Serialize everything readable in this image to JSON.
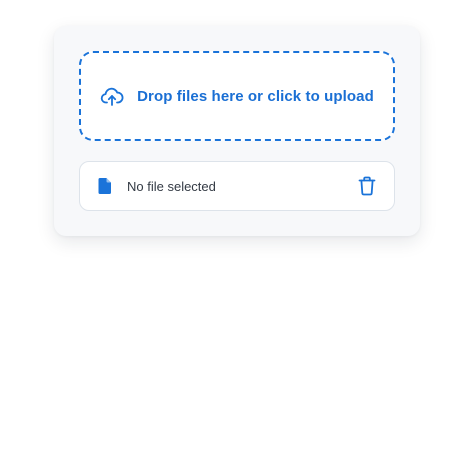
{
  "uploader": {
    "drop_label": "Drop files here or click to upload",
    "upload_icon": "cloud-upload-icon"
  },
  "file_status": {
    "label": "No file selected",
    "file_icon": "file-icon",
    "delete_icon": "trash-icon"
  },
  "colors": {
    "accent": "#1a73d9",
    "card_background": "#f7f8fa",
    "text": "#333a44",
    "border": "#dde3ea"
  }
}
